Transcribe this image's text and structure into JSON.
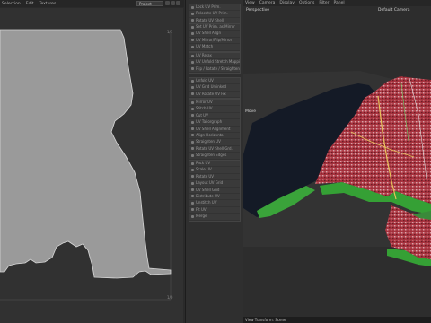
{
  "uv_editor": {
    "menu": [
      "Selection",
      "Edit",
      "Textures"
    ],
    "project_select": "Project",
    "tick_labels": {
      "top_right": "1/1",
      "bottom_right": "1/0"
    }
  },
  "tool_panel": {
    "groups": [
      {
        "rows": [
          "Lock UV Prim.",
          "Relocate UV Prim.",
          "Rotate UV Shell"
        ]
      },
      {
        "rows": [
          "Set UV Prim. as Mirror",
          "UV Shell Align",
          "UV Mirror/Flip/Mirror",
          "UV Match"
        ]
      },
      {
        "rows": [
          "UV Relax",
          "UV Unfold Stretch Mapping",
          "Flip / Rotate / Straighten"
        ]
      },
      {
        "rows": [
          "Unfold UV",
          "UV Grid Unlinked",
          "UV Rotate UV Fix"
        ]
      },
      {
        "rows": [
          "Mirror UV",
          "Stitch UV",
          "Cut UV",
          "UV Tailorgraph",
          "UV Shell Alignment",
          "Align Horizontal",
          "Straighten UV",
          "Rotate UV Shell Grd.",
          "Straighten Edges"
        ]
      },
      {
        "rows": [
          "Pack UV",
          "Scale UV",
          "Rotate UV",
          "Layout UV Grid",
          "UV Shell Grid",
          "Distribute UV",
          "Unstitch UV",
          "Fit UV",
          "Merge"
        ]
      }
    ]
  },
  "viewport": {
    "menu": [
      "View",
      "Camera",
      "Display",
      "Options",
      "Filter",
      "Panel"
    ],
    "perspective_label": "Perspective",
    "camera_label": "Default Camera",
    "move_label": "Move",
    "status": "View Transform: Scene"
  }
}
